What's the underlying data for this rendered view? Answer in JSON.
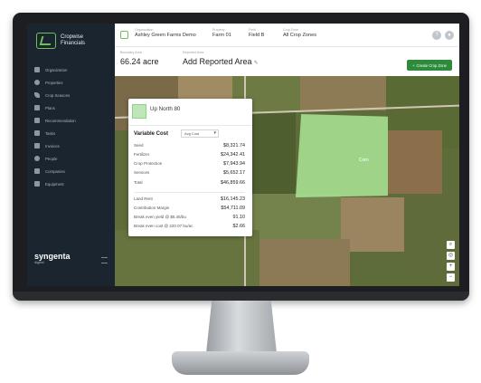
{
  "app": {
    "logo_line1": "Cropwise",
    "logo_line2": "Financials",
    "brand": "syngenta",
    "brand_sub": "digital"
  },
  "sidebar": {
    "items": [
      {
        "label": "Organization",
        "icon": "building-icon"
      },
      {
        "label": "Properties",
        "icon": "map-pin-icon"
      },
      {
        "label": "Crop Seasons",
        "icon": "leaf-icon"
      },
      {
        "label": "Plans",
        "icon": "clipboard-icon"
      },
      {
        "label": "Recommendation",
        "icon": "document-icon"
      },
      {
        "label": "Tasks",
        "icon": "list-icon"
      },
      {
        "label": "Invoices",
        "icon": "invoice-icon"
      },
      {
        "label": "People",
        "icon": "people-icon"
      },
      {
        "label": "Companies",
        "icon": "company-icon"
      },
      {
        "label": "Equipment",
        "icon": "tractor-icon"
      }
    ]
  },
  "header": {
    "organization_label": "Organization",
    "organization": "Ashley Green Farms Demo",
    "property_label": "Property",
    "property": "Farm 01",
    "field_label": "Field",
    "field": "Field B",
    "cropzone_label": "Crop Zone",
    "cropzone": "All Crop Zones"
  },
  "subheader": {
    "boundary_label": "Boundary Area",
    "boundary_value": "66.24 acre",
    "reported_label": "Reported Area",
    "reported_value": "Add Reported Area",
    "create_button": "Create Crop Zone"
  },
  "map": {
    "zone_label": "Corn",
    "zone_color": "#aae696"
  },
  "card": {
    "title": "Up North 80",
    "section_title": "Variable Cost",
    "select_value": "Avg Cost",
    "rows": [
      {
        "label": "Seed",
        "value": "$8,321.74"
      },
      {
        "label": "Fertilizer",
        "value": "$24,342.41"
      },
      {
        "label": "Crop Protection",
        "value": "$7,943.94"
      },
      {
        "label": "Services",
        "value": "$5,652.17"
      },
      {
        "label": "Total",
        "value": "$46,859.66"
      }
    ],
    "rows2": [
      {
        "label": "Land Rent",
        "value": "$16,145.23"
      },
      {
        "label": "Contribution Margin",
        "value": "$54,711.09"
      },
      {
        "label": "Break even yield @ $5.45/bu",
        "value": "91.10"
      },
      {
        "label": "Break even cost @ 220.07 bu/ac",
        "value": "$2.66"
      }
    ]
  }
}
